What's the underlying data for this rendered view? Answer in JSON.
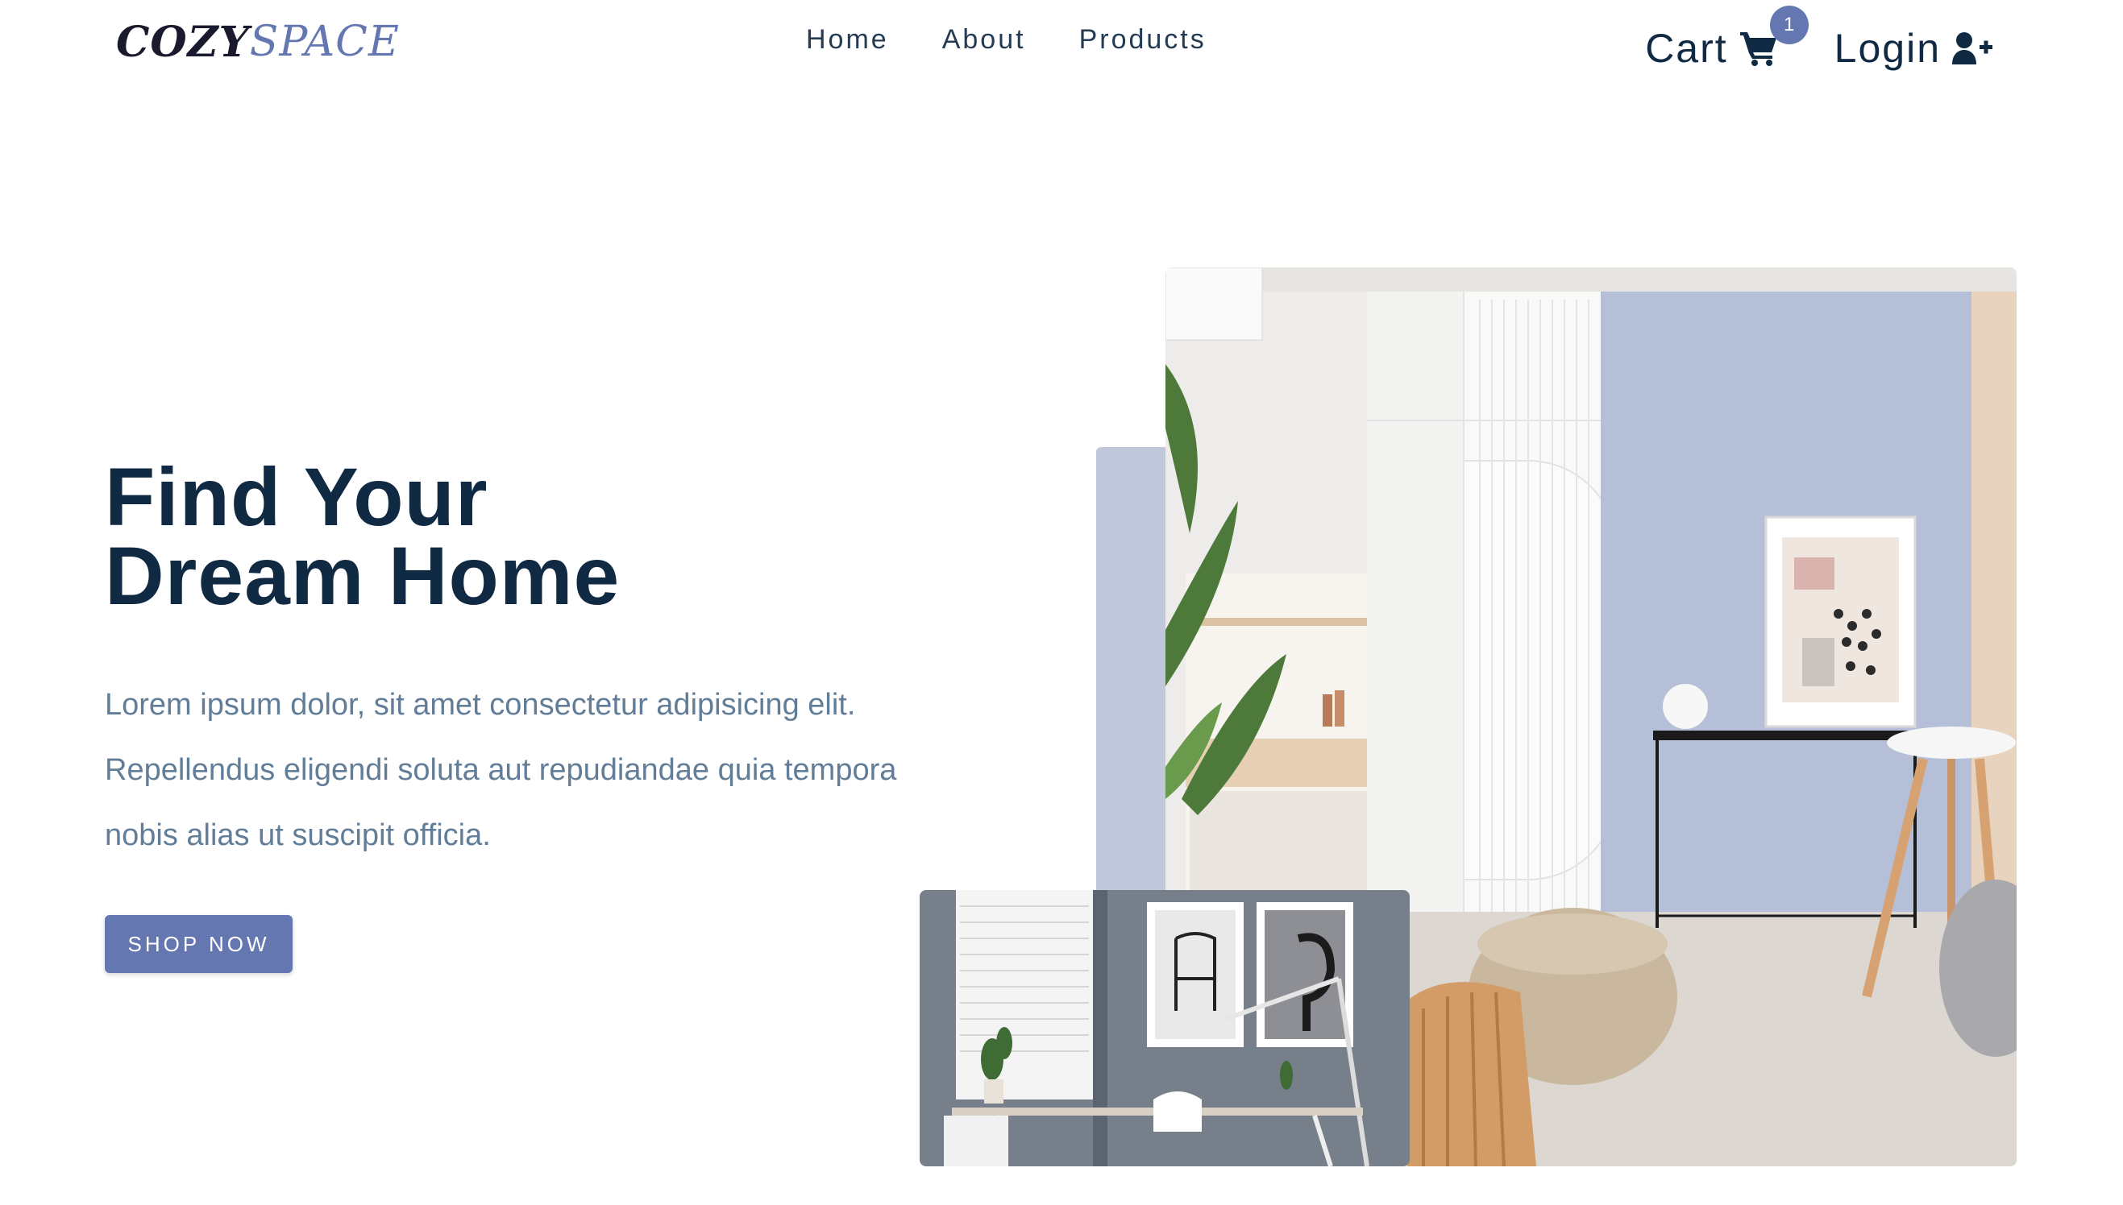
{
  "brand": {
    "part1": "COZY",
    "part2": "SPACE"
  },
  "nav": {
    "links": [
      "Home",
      "About",
      "Products"
    ],
    "cart_label": "Cart",
    "cart_count": "1",
    "login_label": "Login"
  },
  "hero": {
    "title_line1": "Find Your",
    "title_line2": "Dream Home",
    "text": "Lorem ipsum dolor, sit amet consectetur adipisicing elit. Repellendus eligendi soluta aut repudiandae quia tempora nobis alias ut suscipit officia.",
    "button_label": "SHOP NOW"
  },
  "colors": {
    "primary": "#6477b0",
    "heading": "#102a43",
    "body_text": "#627d98",
    "accent_bar": "#c2c8dc"
  },
  "icons": {
    "cart": "shopping-cart-icon",
    "login": "user-plus-icon"
  }
}
